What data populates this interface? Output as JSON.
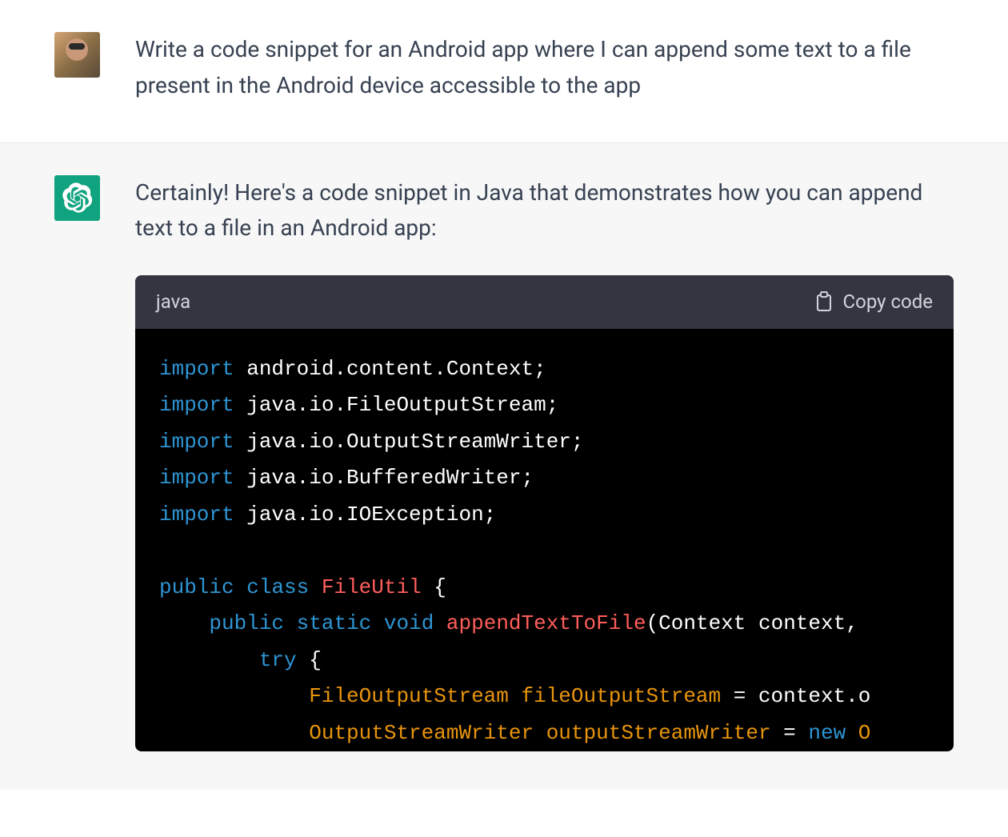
{
  "conversation": {
    "user": {
      "avatar_desc": "user-photo",
      "text": "Write a code snippet for an Android app where I can append some text to a file present in the Android device accessible to the app"
    },
    "assistant": {
      "avatar_desc": "openai-logo",
      "intro_text": "Certainly! Here's a code snippet in Java that demonstrates how you can append text to a file in an Android app:",
      "code": {
        "language": "java",
        "copy_label": "Copy code",
        "tokens": [
          [
            [
              "import",
              "keyword"
            ],
            [
              " android.content.Context;",
              "plain"
            ]
          ],
          [
            [
              "import",
              "keyword"
            ],
            [
              " java.io.FileOutputStream;",
              "plain"
            ]
          ],
          [
            [
              "import",
              "keyword"
            ],
            [
              " java.io.OutputStreamWriter;",
              "plain"
            ]
          ],
          [
            [
              "import",
              "keyword"
            ],
            [
              " java.io.BufferedWriter;",
              "plain"
            ]
          ],
          [
            [
              "import",
              "keyword"
            ],
            [
              " java.io.IOException;",
              "plain"
            ]
          ],
          [],
          [
            [
              "public",
              "keyword"
            ],
            [
              " ",
              "plain"
            ],
            [
              "class",
              "keyword"
            ],
            [
              " ",
              "plain"
            ],
            [
              "FileUtil",
              "class"
            ],
            [
              " {",
              "plain"
            ]
          ],
          [
            [
              "    ",
              "plain"
            ],
            [
              "public",
              "keyword"
            ],
            [
              " ",
              "plain"
            ],
            [
              "static",
              "keyword"
            ],
            [
              " ",
              "plain"
            ],
            [
              "void",
              "keyword"
            ],
            [
              " ",
              "plain"
            ],
            [
              "appendTextToFile",
              "method"
            ],
            [
              "(Context context,",
              "plain"
            ]
          ],
          [
            [
              "        ",
              "plain"
            ],
            [
              "try",
              "keyword"
            ],
            [
              " {",
              "plain"
            ]
          ],
          [
            [
              "            ",
              "plain"
            ],
            [
              "FileOutputStream",
              "type"
            ],
            [
              " ",
              "plain"
            ],
            [
              "fileOutputStream",
              "type"
            ],
            [
              " = context.o",
              "plain"
            ]
          ],
          [
            [
              "            ",
              "plain"
            ],
            [
              "OutputStreamWriter",
              "type"
            ],
            [
              " ",
              "plain"
            ],
            [
              "outputStreamWriter",
              "type"
            ],
            [
              " = ",
              "plain"
            ],
            [
              "new",
              "new"
            ],
            [
              " ",
              "plain"
            ],
            [
              "O",
              "type"
            ]
          ]
        ]
      }
    }
  }
}
